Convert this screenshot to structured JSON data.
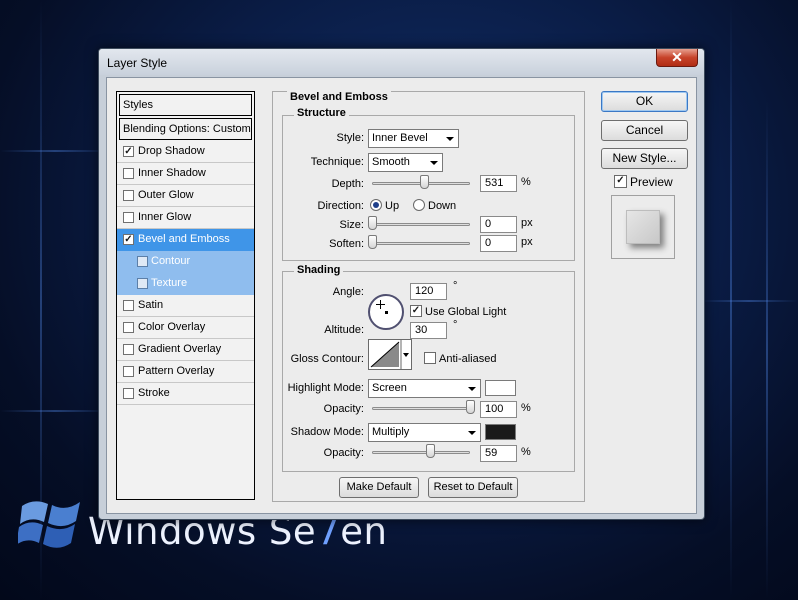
{
  "brand": {
    "word_start": "Windows Se",
    "seven": "7",
    "word_end": "en"
  },
  "window": {
    "title": "Layer Style",
    "close_glyph": "✕"
  },
  "styles_list": {
    "header": "Styles",
    "blending": "Blending Options: Custom",
    "items": [
      {
        "label": "Drop Shadow",
        "checked": true
      },
      {
        "label": "Inner Shadow",
        "checked": false
      },
      {
        "label": "Outer Glow",
        "checked": false
      },
      {
        "label": "Inner Glow",
        "checked": false
      },
      {
        "label": "Bevel and Emboss",
        "checked": true,
        "selected": true
      },
      {
        "label": "Contour",
        "checked": false,
        "sub": true
      },
      {
        "label": "Texture",
        "checked": false,
        "sub": true
      },
      {
        "label": "Satin",
        "checked": false
      },
      {
        "label": "Color Overlay",
        "checked": false
      },
      {
        "label": "Gradient Overlay",
        "checked": false
      },
      {
        "label": "Pattern Overlay",
        "checked": false
      },
      {
        "label": "Stroke",
        "checked": false
      }
    ]
  },
  "bevel": {
    "title": "Bevel and Emboss",
    "structure": {
      "title": "Structure",
      "style_label": "Style:",
      "style_value": "Inner Bevel",
      "technique_label": "Technique:",
      "technique_value": "Smooth",
      "depth_label": "Depth:",
      "depth_value": "531",
      "depth_unit": "%",
      "depth_slider": 0.53,
      "direction_label": "Direction:",
      "dir_up": "Up",
      "dir_down": "Down",
      "size_label": "Size:",
      "size_value": "0",
      "size_unit": "px",
      "size_slider": 0,
      "soften_label": "Soften:",
      "soften_value": "0",
      "soften_unit": "px",
      "soften_slider": 0
    },
    "shading": {
      "title": "Shading",
      "angle_label": "Angle:",
      "angle_value": "120",
      "angle_unit": "°",
      "use_global_light": "Use Global Light",
      "altitude_label": "Altitude:",
      "altitude_value": "30",
      "altitude_unit": "°",
      "gloss_label": "Gloss Contour:",
      "anti_aliased": "Anti-aliased",
      "highlight_label": "Highlight Mode:",
      "highlight_value": "Screen",
      "highlight_color": "#ffffff",
      "opacity1_label": "Opacity:",
      "opacity1_value": "100",
      "opacity1_unit": "%",
      "opacity1_slider": 1.0,
      "shadow_label": "Shadow Mode:",
      "shadow_value": "Multiply",
      "shadow_color": "#1a1a1a",
      "opacity2_label": "Opacity:",
      "opacity2_value": "59",
      "opacity2_unit": "%",
      "opacity2_slider": 0.59
    },
    "make_default": "Make Default",
    "reset_default": "Reset to Default"
  },
  "actions": {
    "ok": "OK",
    "cancel": "Cancel",
    "new_style": "New Style...",
    "preview": "Preview"
  },
  "colors": {
    "selected": "#3f95e8",
    "sub_selected": "#8fbdee"
  },
  "icons": {
    "close": "close-icon",
    "check": "checkmark-icon",
    "dropdown": "chevron-down-icon"
  }
}
